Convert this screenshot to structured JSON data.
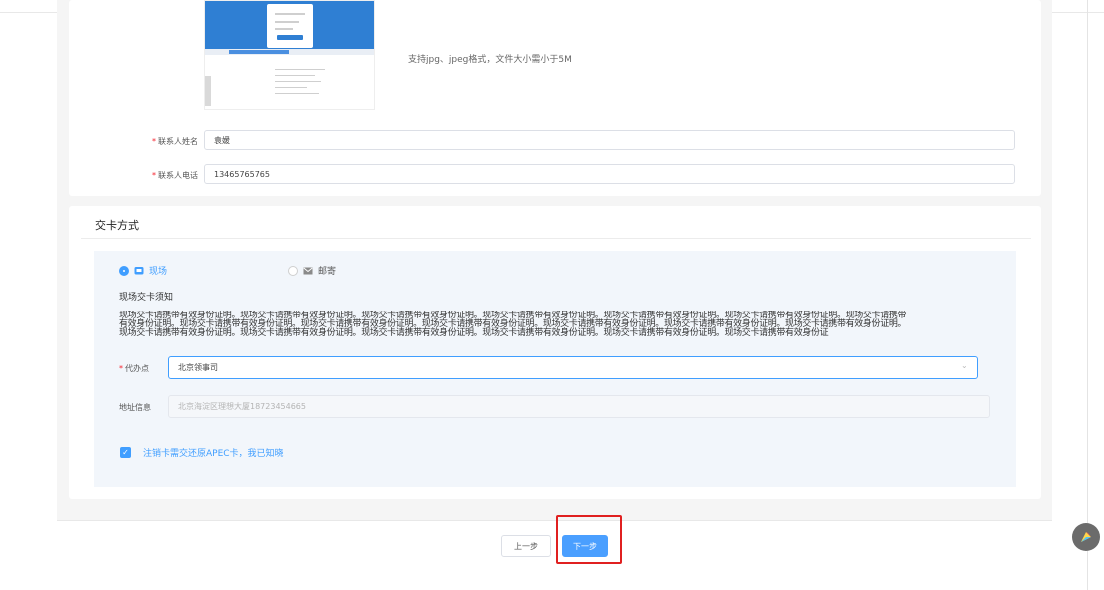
{
  "upload": {
    "tip": "支持jpg、jpeg格式，文件大小需小于5M"
  },
  "contact": {
    "name_label": "联系人姓名",
    "name_value": "袁媛",
    "phone_label": "联系人电话",
    "phone_value": "13465765765",
    "required_mark": "*"
  },
  "delivery": {
    "section_title": "交卡方式",
    "options": [
      {
        "label": "现场",
        "icon": "onsite-icon",
        "selected": true
      },
      {
        "label": "邮寄",
        "icon": "mail-icon",
        "selected": false
      }
    ],
    "notice_title": "现场交卡须知",
    "notice_lines": [
      "现场交卡请携带有效身份证明。现场交卡请携带有效身份证明。现场交卡请携带有效身份证明。现场交卡请携带有效身份证明。现场交卡请携带有效身份证明。现场交卡请携带有效身份证明。现场交卡请携带",
      "有效身份证明。现场交卡请携带有效身份证明。现场交卡请携带有效身份证明。现场交卡请携带有效身份证明。现场交卡请携带有效身份证明。现场交卡请携带有效身份证明。现场交卡请携带有效身份证明。",
      "现场交卡请携带有效身份证明。现场交卡请携带有效身份证明。现场交卡请携带有效身份证明。现场交卡请携带有效身份证明。现场交卡请携带有效身份证明。现场交卡请携带有效身份证"
    ],
    "agency_label": "代办点",
    "agency_value": "北京领事司",
    "address_label": "地址信息",
    "address_value": "北京海淀区理想大厦18723454665",
    "agreement_text": "注销卡需交还原APEC卡，我已知晓",
    "agreement_checked": true
  },
  "actions": {
    "prev_label": "上一步",
    "next_label": "下一步"
  },
  "colors": {
    "accent": "#409eff",
    "highlight": "#e02020",
    "required": "#f5222d"
  }
}
